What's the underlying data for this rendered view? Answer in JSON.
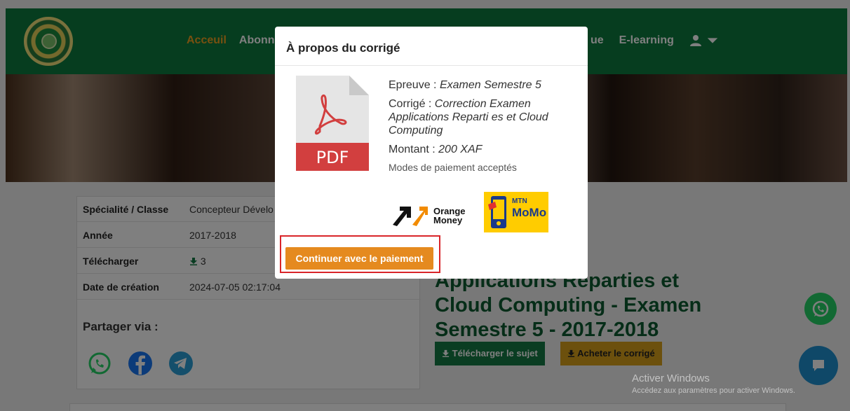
{
  "navbar": {
    "links": [
      "Acceuil",
      "Abonn"
    ],
    "right_links": [
      "ue",
      "E-learning"
    ]
  },
  "info_table": [
    {
      "key": "Spécialité / Classe",
      "value": "Concepteur Dévelo"
    },
    {
      "key": "Année",
      "value": "2017-2018"
    },
    {
      "key": "Télécharger",
      "value": "3"
    },
    {
      "key": "Date de création",
      "value": "2024-07-05 02:17:04"
    }
  ],
  "share": {
    "title": "Partager via :"
  },
  "document": {
    "title_lines": [
      "Applications Reparties et",
      "Cloud Computing - Examen",
      "Semestre 5 - 2017-2018"
    ],
    "download_label": "Télécharger le sujet",
    "buy_label": "Acheter le corrigé"
  },
  "modal": {
    "title": "À propos du corrigé",
    "pdf_label": "PDF",
    "epreuve_label": "Epreuve : ",
    "epreuve_value": "Examen Semestre 5",
    "corrige_label": "Corrigé : ",
    "corrige_value": "Correction Examen Applications Reparti es et Cloud Computing",
    "montant_label": "Montant : ",
    "montant_value": "200 XAF",
    "payment_modes_label": "Modes de paiement acceptés",
    "orange_money_line1": "Orange",
    "orange_money_line2": "Money",
    "mtn_line1": "MTN",
    "mtn_line2": "MoMo",
    "continue_button": "Continuer avec le paiement"
  },
  "windows_watermark": {
    "line1": "Activer Windows",
    "line2": "Accédez aux paramètres pour activer Windows."
  },
  "colors": {
    "navbar": "#0d7a3e",
    "accent_orange": "#e58a1f",
    "highlight_red": "#d9252a",
    "title_green": "#0d5a30"
  }
}
